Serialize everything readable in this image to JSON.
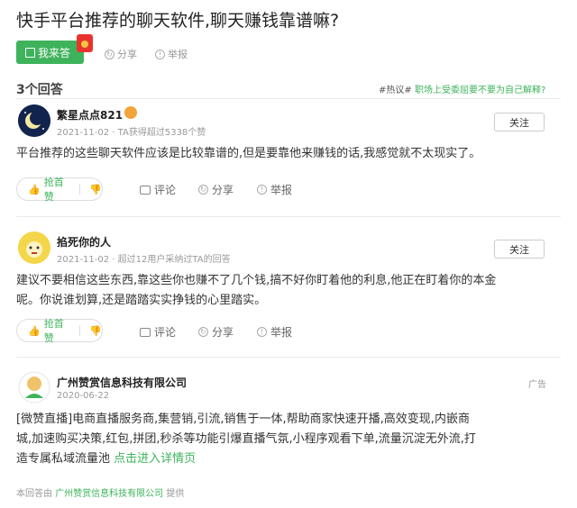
{
  "question": {
    "title": "快手平台推荐的聊天软件,聊天赚钱靠谱嘛?",
    "answer_button": "我来答",
    "share": "分享",
    "report": "举报"
  },
  "answers_header": {
    "count": "3个回答",
    "hot_tag": "#热议#",
    "hot_question": "职场上受委屈要不要为自己解释?"
  },
  "answers": [
    {
      "author": "繁星点点821",
      "date": "2021-11-02",
      "meta": "TA获得超过5338个赞",
      "follow": "关注",
      "content": "平台推荐的这些聊天软件应该是比较靠谱的,但是要靠他来赚钱的话,我感觉就不太现实了。",
      "vote": "抢首赞",
      "comment": "评论",
      "share": "分享",
      "report": "举报"
    },
    {
      "author": "掐死你的人",
      "date": "2021-11-02",
      "meta": "超过12用户采纳过TA的回答",
      "follow": "关注",
      "content_line1": "建议不要相信这些东西,靠这些你也赚不了几个钱,搞不好你盯着他的利息,他正在盯着你的本金",
      "content_line2": "呢。你说谁划算,还是踏踏实实挣钱的心里踏实。",
      "vote": "抢首赞",
      "comment": "评论",
      "share": "分享",
      "report": "举报"
    }
  ],
  "ad": {
    "company": "广州赞赏信息科技有限公司",
    "date": "2020-06-22",
    "tag": "广告",
    "line1": "[微赞直播]电商直播服务商,集营销,引流,销售于一体,帮助商家快速开播,高效变现,内嵌商",
    "line2": "城,加速购买决策,红包,拼团,秒杀等功能引爆直播气氛,小程序观看下单,流量沉淀无外流,打",
    "line3": "造专属私域流量池",
    "link": "点击进入详情页"
  },
  "footer": {
    "prefix": "本回答由",
    "company": "广州赞赏信息科技有限公司",
    "suffix": "提供"
  },
  "colors": {
    "accent": "#3eb35c",
    "ad_avatar": "#f0c36b"
  }
}
